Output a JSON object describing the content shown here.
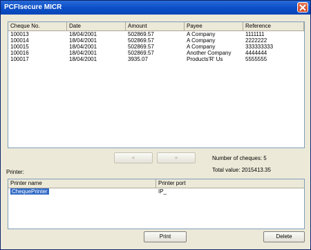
{
  "window": {
    "title": "PCFIsecure MICR"
  },
  "cheques": {
    "columns": [
      "Cheque No.",
      "Date",
      "Amount",
      "Payee",
      "Reference"
    ],
    "rows": [
      [
        "100013",
        "18/04/2001",
        "502869.57",
        "A Company",
        "1111111"
      ],
      [
        "100014",
        "18/04/2001",
        "502869.57",
        "A Company",
        "2222222"
      ],
      [
        "100015",
        "18/04/2001",
        "502869.57",
        "A Company",
        "333333333"
      ],
      [
        "100016",
        "18/04/2001",
        "502869.57",
        "Another Company",
        "4444444"
      ],
      [
        "100017",
        "18/04/2001",
        "3935.07",
        "Products'R' Us",
        "5555555"
      ]
    ]
  },
  "nav": {
    "prev_label": "«",
    "next_label": "»"
  },
  "summary": {
    "count_text": "Number of cheques: 5",
    "total_text": "Total value: 2015413.35"
  },
  "printer": {
    "section_label": "Printer:",
    "columns": [
      "Printer name",
      "Printer port"
    ],
    "rows": [
      [
        "ChequePrinter",
        "IP_"
      ]
    ]
  },
  "actions": {
    "print_label": "Print",
    "delete_label": "Delete"
  }
}
